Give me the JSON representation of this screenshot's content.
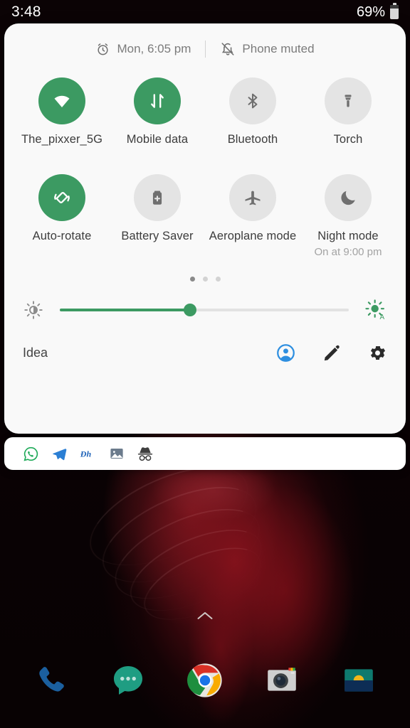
{
  "statusbar": {
    "time": "3:48",
    "battery_percent": "69%"
  },
  "quick_settings": {
    "header": {
      "alarm_text": "Mon, 6:05 pm",
      "ringer_text": "Phone muted"
    },
    "tiles": [
      {
        "label": "The_pixxer_5G",
        "icon": "wifi-icon",
        "active": true,
        "sub": ""
      },
      {
        "label": "Mobile data",
        "icon": "mobile-data-icon",
        "active": true,
        "sub": ""
      },
      {
        "label": "Bluetooth",
        "icon": "bluetooth-icon",
        "active": false,
        "sub": ""
      },
      {
        "label": "Torch",
        "icon": "flashlight-icon",
        "active": false,
        "sub": ""
      },
      {
        "label": "Auto-rotate",
        "icon": "auto-rotate-icon",
        "active": true,
        "sub": ""
      },
      {
        "label": "Battery Saver",
        "icon": "battery-plus-icon",
        "active": false,
        "sub": ""
      },
      {
        "label": "Aeroplane mode",
        "icon": "airplane-icon",
        "active": false,
        "sub": ""
      },
      {
        "label": "Night mode",
        "icon": "moon-icon",
        "active": false,
        "sub": "On at 9:00 pm"
      }
    ],
    "pager": {
      "pages": 3,
      "active_page": 1
    },
    "brightness": {
      "value_percent": 45,
      "left_icon": "brightness-low-icon",
      "right_icon": "auto-brightness-icon"
    },
    "footer": {
      "carrier": "Idea",
      "icons": [
        {
          "name": "user-account-icon"
        },
        {
          "name": "edit-pencil-icon"
        },
        {
          "name": "settings-gear-icon"
        }
      ]
    }
  },
  "notification_shade": {
    "icons": [
      {
        "name": "whatsapp-icon"
      },
      {
        "name": "telegram-icon"
      },
      {
        "name": "dh-app-icon",
        "text": "Dh"
      },
      {
        "name": "gallery-icon"
      },
      {
        "name": "incognito-icon"
      }
    ]
  },
  "home": {
    "drawer_indicator_icon": "chevron-up-icon",
    "dock_apps": [
      {
        "name": "phone-app-icon"
      },
      {
        "name": "messages-app-icon"
      },
      {
        "name": "chrome-app-icon"
      },
      {
        "name": "camera-app-icon"
      },
      {
        "name": "gallery-app-icon"
      }
    ]
  },
  "colors": {
    "accent_green": "#3c9a62",
    "panel_background": "#f9f9f9",
    "tile_inactive": "#e4e4e4",
    "account_blue": "#2e8fe0"
  }
}
